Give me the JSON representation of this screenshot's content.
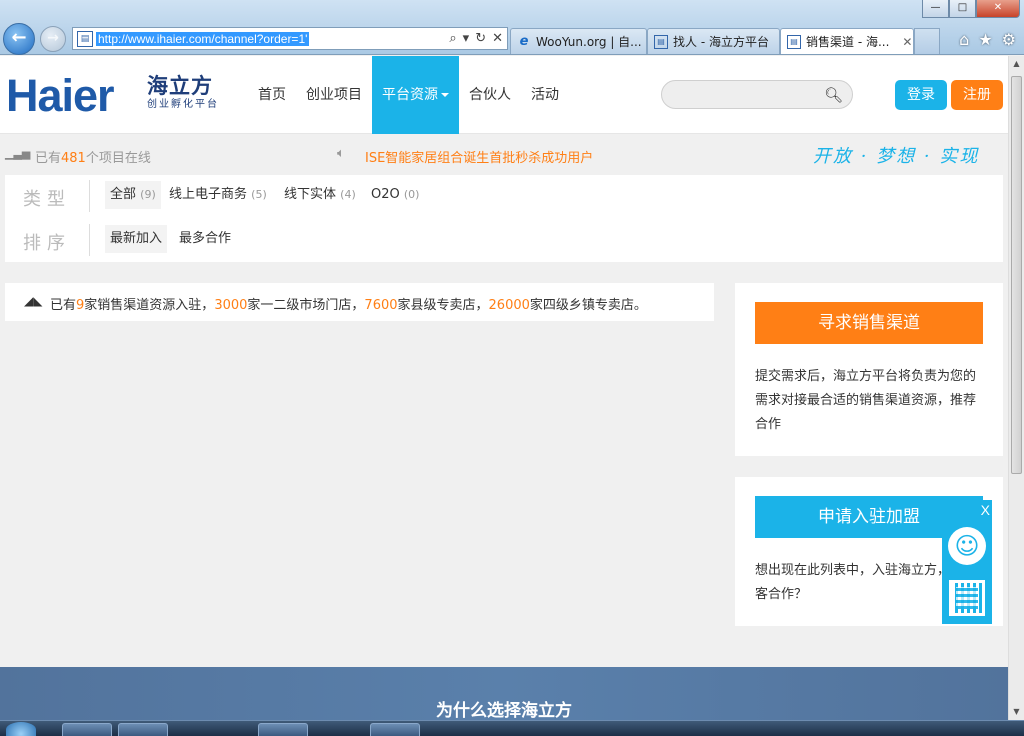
{
  "browser": {
    "url": "http://www.ihaier.com/channel?order=1'",
    "tabs": [
      {
        "label": "WooYun.org | 自...",
        "active": false
      },
      {
        "label": "找人 - 海立方平台",
        "active": false
      },
      {
        "label": "销售渠道 - 海...",
        "active": true
      }
    ],
    "window_buttons": {
      "minimize": "—",
      "maximize": "□",
      "close": "✕"
    }
  },
  "header": {
    "logo": "Haier",
    "logo_cn": "海立方",
    "logo_sub": "创业孵化平台",
    "nav": [
      {
        "label": "首页",
        "active": false
      },
      {
        "label": "创业项目",
        "active": false
      },
      {
        "label": "平台资源",
        "active": true
      },
      {
        "label": "合伙人",
        "active": false
      },
      {
        "label": "活动",
        "active": false
      }
    ],
    "search_placeholder": "",
    "login_label": "登录",
    "register_label": "注册"
  },
  "infobar": {
    "count_prefix": "已有",
    "count_value": "481",
    "count_suffix": "个项目在线",
    "notice": "ISE智能家居组合诞生首批秒杀成功用户",
    "slogan": "开放 · 梦想 · 实现"
  },
  "filter": {
    "type_label": "类型",
    "types": [
      {
        "label": "全部",
        "count": "(9)"
      },
      {
        "label": "线上电子商务",
        "count": "(5)"
      },
      {
        "label": "线下实体",
        "count": "(4)"
      },
      {
        "label": "O2O",
        "count": "(0)"
      }
    ],
    "sort_label": "排序",
    "sorts": [
      {
        "label": "最新加入"
      },
      {
        "label": "最多合作"
      }
    ]
  },
  "summary": {
    "p1": "已有",
    "n1": "9",
    "p2": "家销售渠道资源入驻，",
    "n2": "3000",
    "p3": "家一二级市场门店，",
    "n3": "7600",
    "p4": "家县级专卖店，",
    "n4": "26000",
    "p5": "家四级乡镇专卖店。"
  },
  "cards": [
    {
      "cta": "寻求销售渠道",
      "desc": "提交需求后，海立方平台将负责为您的需求对接最合适的销售渠道资源，推荐合作"
    },
    {
      "cta": "申请入驻加盟",
      "desc": "想出现在此列表中，入驻海立方，与创客合作？"
    }
  ],
  "float_widget": {
    "close": "X"
  },
  "band": {
    "title": "为什么选择海立方"
  },
  "colors": {
    "brand_blue": "#1bb3e8",
    "brand_orange": "#ff7f15",
    "logo_blue": "#1f5aa8"
  }
}
